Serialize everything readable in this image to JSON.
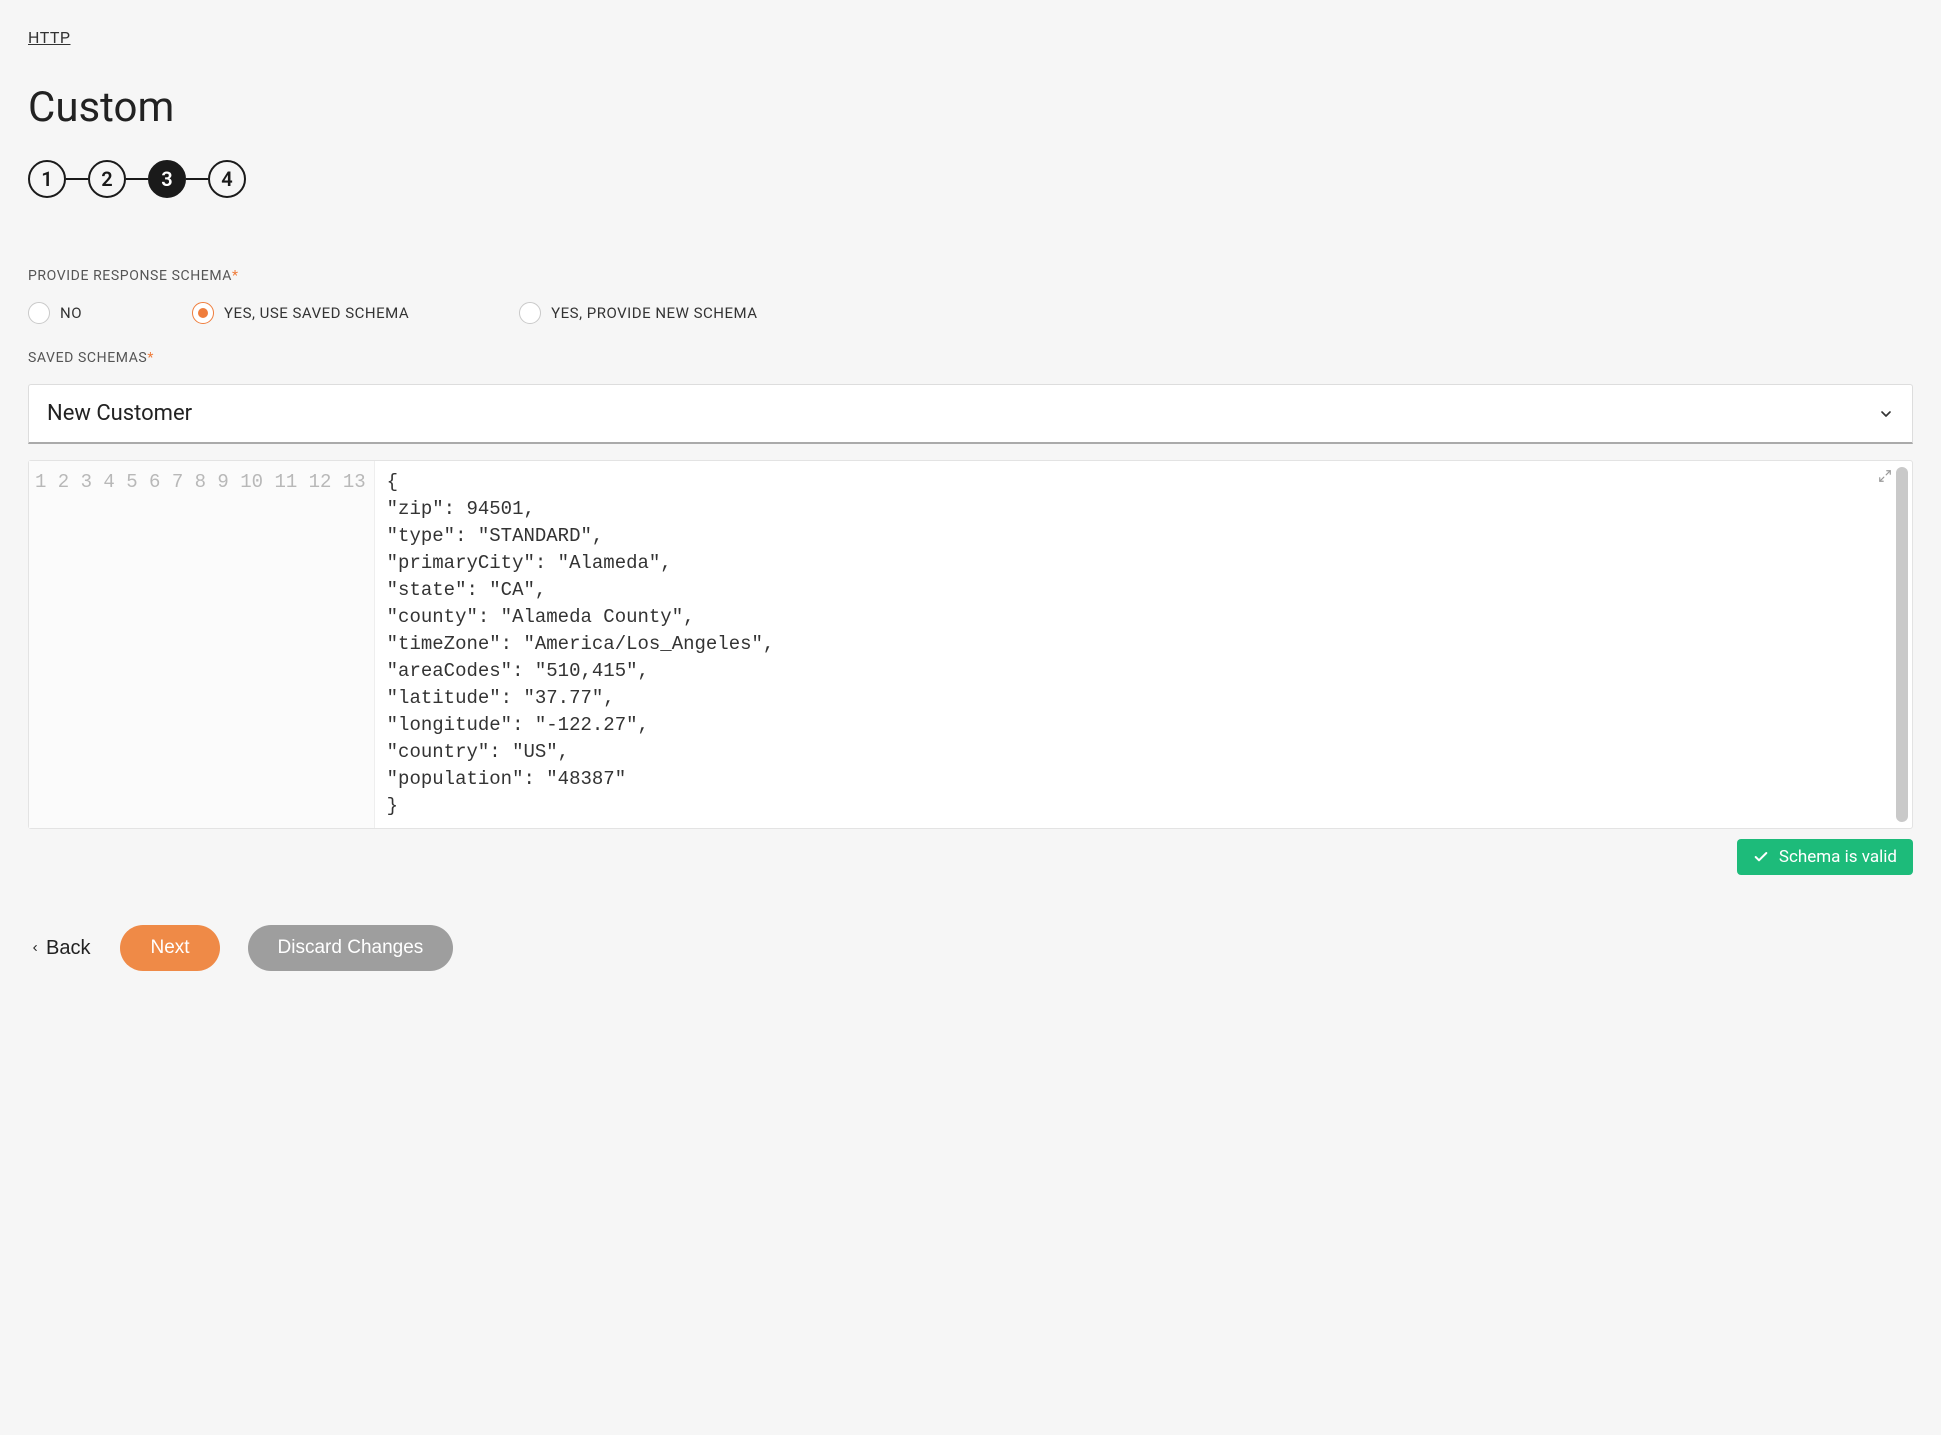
{
  "breadcrumb": "HTTP",
  "title": "Custom",
  "stepper": {
    "steps": [
      "1",
      "2",
      "3",
      "4"
    ],
    "active_index": 2
  },
  "schema_section": {
    "label": "PROVIDE RESPONSE SCHEMA",
    "options": [
      {
        "label": "NO",
        "selected": false
      },
      {
        "label": "YES, USE SAVED SCHEMA",
        "selected": true
      },
      {
        "label": "YES, PROVIDE NEW SCHEMA",
        "selected": false
      }
    ]
  },
  "saved_schemas": {
    "label": "SAVED SCHEMAS",
    "selected": "New Customer"
  },
  "editor": {
    "lines": [
      "{",
      "\"zip\": 94501,",
      "\"type\": \"STANDARD\",",
      "\"primaryCity\": \"Alameda\",",
      "\"state\": \"CA\",",
      "\"county\": \"Alameda County\",",
      "\"timeZone\": \"America/Los_Angeles\",",
      "\"areaCodes\": \"510,415\",",
      "\"latitude\": \"37.77\",",
      "\"longitude\": \"-122.27\",",
      "\"country\": \"US\",",
      "\"population\": \"48387\"",
      "}"
    ]
  },
  "validation": {
    "message": "Schema is valid"
  },
  "footer": {
    "back": "Back",
    "next": "Next",
    "discard": "Discard Changes"
  },
  "required_marker": "*"
}
